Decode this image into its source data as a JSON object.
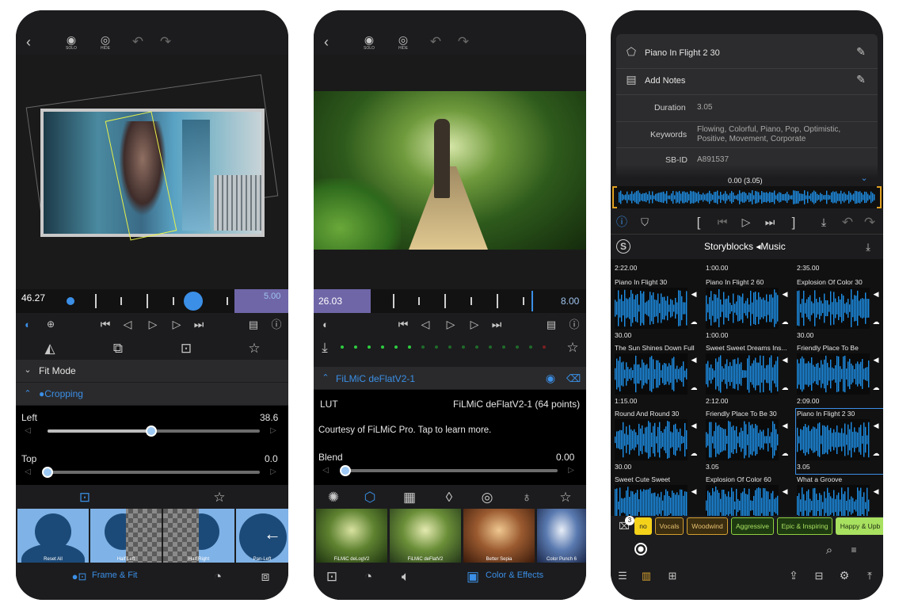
{
  "colors": {
    "accent": "#3b8fe6",
    "panel": "#1c1c1e",
    "wave": "#1e90e8",
    "lut_bar": "#7a6fb0"
  },
  "phone1": {
    "toolbar": {
      "solo": "SOLO",
      "hide": "HIDE"
    },
    "timeline": {
      "left_value": "46.27",
      "right_value": "5.00"
    },
    "fit_mode": "Fit Mode",
    "cropping": "●Cropping",
    "left": {
      "label": "Left",
      "value": "38.6",
      "fraction": 0.49
    },
    "top": {
      "label": "Top",
      "value": "0.0",
      "fraction": 0.0
    },
    "thumbs": [
      "Reset All",
      "Half Left",
      "Half Right",
      "Pan-Left"
    ],
    "bottom_tab": "Frame & Fit"
  },
  "phone2": {
    "toolbar": {
      "solo": "SOLO",
      "hide": "HIDE"
    },
    "timeline": {
      "left_value": "26.03",
      "right_value": "8.00"
    },
    "filter_name": "FiLMiC deFlatV2-1",
    "lut_label": "LUT",
    "lut_value": "FiLMiC deFlatV2-1 (64 points)",
    "courtesy": "Courtesy of FiLMiC Pro. Tap to learn more.",
    "blend": {
      "label": "Blend",
      "value": "0.00",
      "fraction": 0.0
    },
    "thumbs": [
      "FiLMiC deLogV2",
      "FiLMiC deFlatV2",
      "Better Sepia",
      "Color Punch 6"
    ],
    "bottom_tab": "Color & Effects"
  },
  "phone3": {
    "info": {
      "title": "Piano In Flight 2 30",
      "notes": "Add Notes",
      "duration_label": "Duration",
      "duration": "3.05",
      "keywords_label": "Keywords",
      "keywords": "Flowing, Colorful, Piano, Pop, Optimistic, Positive, Movement, Corporate",
      "sbid_label": "SB-ID",
      "sbid": "A891537"
    },
    "time_readout": "0.00 (3.05)",
    "header": "Storyblocks ◂Music",
    "top_durations": [
      "2:22.00",
      "1:00.00",
      "2:35.00"
    ],
    "tracks": [
      {
        "title": "Piano In Flight 30",
        "dur": "30.00"
      },
      {
        "title": "Piano In Flight 2 60",
        "dur": "1:00.00"
      },
      {
        "title": "Explosion Of Color 30",
        "dur": "30.00"
      },
      {
        "title": "The Sun Shines Down Full",
        "dur": "1:15.00"
      },
      {
        "title": "Sweet Sweet Dreams Ins...",
        "dur": "2:12.00"
      },
      {
        "title": "Friendly Place To Be",
        "dur": "2:09.00"
      },
      {
        "title": "Round And Round 30",
        "dur": "30.00"
      },
      {
        "title": "Friendly Place To Be 30",
        "dur": "3.05"
      },
      {
        "title": "Piano In Flight 2 30",
        "dur": "3.05"
      },
      {
        "title": "Sweet Cute Sweet",
        "dur": ""
      },
      {
        "title": "Explosion Of Color 60",
        "dur": ""
      },
      {
        "title": "What a Groove",
        "dur": ""
      }
    ],
    "filter_badge": "3",
    "tags": [
      "no",
      "Vocals",
      "Woodwind",
      "Aggressive",
      "Epic & Inspiring",
      "Happy & Upb"
    ]
  }
}
